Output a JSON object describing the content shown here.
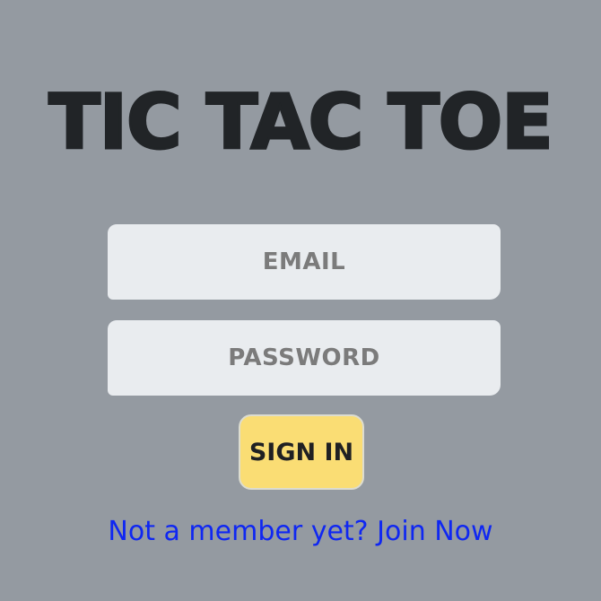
{
  "app": {
    "title": "TIC TAC TOE"
  },
  "form": {
    "email_placeholder": "EMAIL",
    "password_placeholder": "PASSWORD",
    "signin_label": "SIGN IN"
  },
  "footer": {
    "prompt": "Not a member yet?",
    "join_label": "Join Now"
  },
  "colors": {
    "background": "#949aa1",
    "title": "#212427",
    "field_bg": "#e9ecef",
    "placeholder": "#7b7b7b",
    "button_bg": "#fadd74",
    "link": "#0f27f2"
  }
}
